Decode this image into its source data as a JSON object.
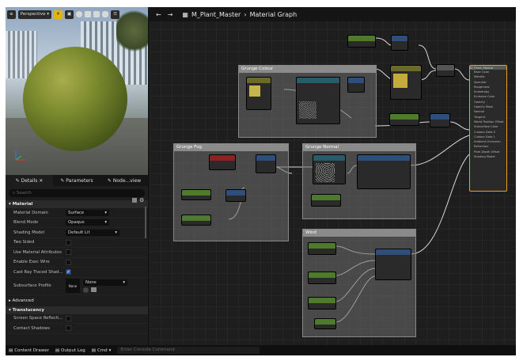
{
  "viewport": {
    "mode_label": "Perspective",
    "icons": [
      "lit-icon",
      "sphere-icon",
      "plane-icon",
      "cube-icon",
      "cylinder-icon",
      "menu-icon"
    ]
  },
  "details": {
    "tabs": [
      "Details",
      "Parameters",
      "Node...view"
    ],
    "search_placeholder": "Search",
    "sections": {
      "material": "Material",
      "advanced": "Advanced",
      "translucency": "Translucency"
    },
    "rows": [
      {
        "label": "Material Domain",
        "value": "Surface",
        "type": "dropdown"
      },
      {
        "label": "Blend Mode",
        "value": "Opaque",
        "type": "dropdown"
      },
      {
        "label": "Shading Model",
        "value": "Default Lit",
        "type": "dropdown"
      },
      {
        "label": "Two Sided",
        "value": "",
        "type": "checkbox",
        "checked": false
      },
      {
        "label": "Use Material Attributes",
        "value": "",
        "type": "checkbox",
        "checked": false
      },
      {
        "label": "Enable Exec Wire",
        "value": "",
        "type": "checkbox",
        "checked": false
      },
      {
        "label": "Cast Ray Traced Shad...",
        "value": "",
        "type": "checkbox",
        "checked": true
      }
    ],
    "subsurface": {
      "label": "Subsurface Profile",
      "thumb": "None",
      "dropdown": "None"
    },
    "translucency_rows": [
      "Screen Space Reflecti...",
      "Contact Shadows"
    ]
  },
  "graph": {
    "title": "M_Plant_Master",
    "breadcrumb": "Material Graph",
    "comments": [
      "Grunge Colour",
      "Grunge Fog",
      "Grunge Normal",
      "Wind"
    ],
    "main_node": {
      "title": "M_Plant_Master",
      "inputs": [
        "Base Color",
        "Metallic",
        "Specular",
        "Roughness",
        "Anisotropy",
        "Emissive Color",
        "Opacity",
        "Opacity Mask",
        "Normal",
        "Tangent",
        "World Position Offset",
        "Subsurface Color",
        "Custom Data 0",
        "Custom Data 1",
        "Ambient Occlusion",
        "Refraction",
        "Pixel Depth Offset",
        "Shading Model"
      ]
    }
  },
  "bottombar": {
    "content_drawer": "Content Drawer",
    "output_log": "Output Log",
    "cmd": "Cmd",
    "console_placeholder": "Enter Console Command"
  }
}
